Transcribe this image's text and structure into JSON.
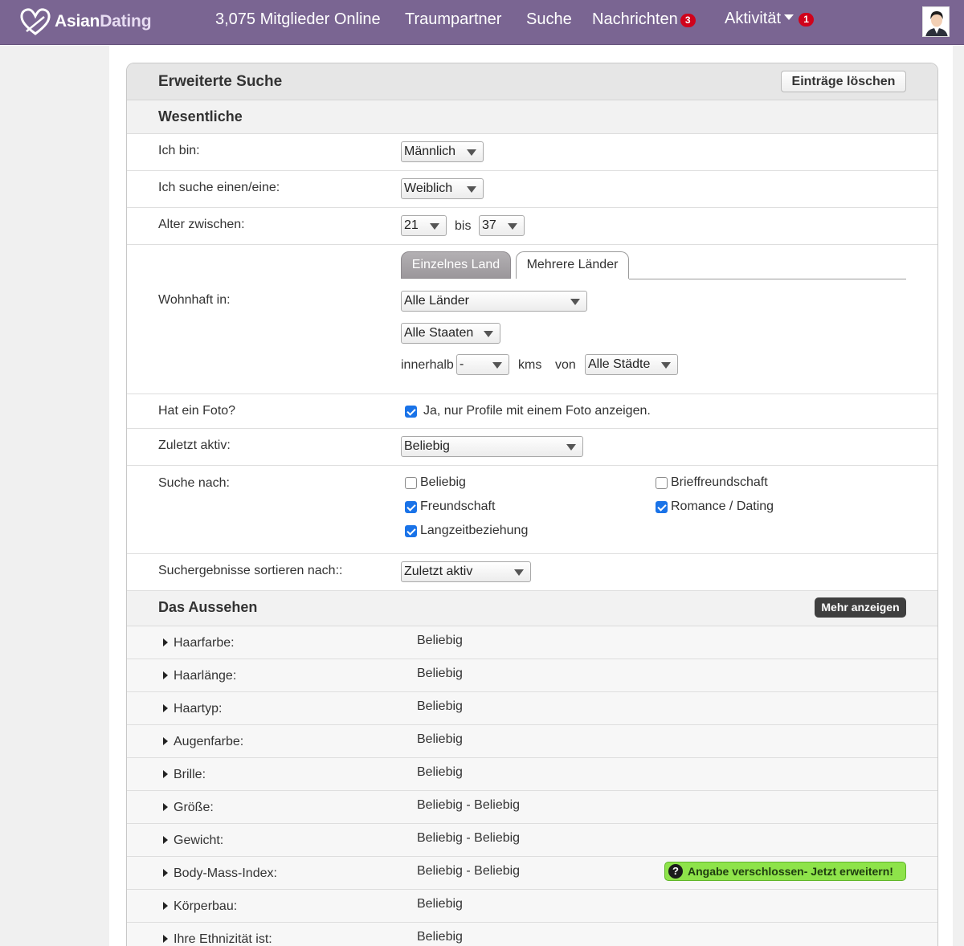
{
  "brand": {
    "name_a": "Asian",
    "name_b": "Dating",
    "color": "#7a6592"
  },
  "nav": {
    "online": "3,075 Mitglieder Online",
    "partner": "Traumpartner",
    "search": "Suche",
    "messages": "Nachrichten",
    "messages_badge": "3",
    "activity": "Aktivität",
    "activity_badge": "1"
  },
  "panel": {
    "title": "Erweiterte Suche",
    "clear_button": "Einträge löschen"
  },
  "essentials": {
    "title": "Wesentliche",
    "i_am": {
      "label": "Ich bin:",
      "value": "Männlich"
    },
    "seeking": {
      "label": "Ich suche einen/eine:",
      "value": "Weiblich"
    },
    "age": {
      "label": "Alter zwischen:",
      "from": "21",
      "between": "bis",
      "to": "37"
    },
    "residence": {
      "label": "Wohnhaft in:",
      "tab_single": "Einzelnes Land",
      "tab_multi": "Mehrere Länder",
      "country": "Alle Länder",
      "state": "Alle Staaten",
      "within_label": "innerhalb",
      "distance": "-",
      "unit": "kms",
      "from_label": "von",
      "city": "Alle Städte"
    },
    "photo": {
      "label": "Hat ein Foto?",
      "text": "Ja, nur Profile mit einem Foto anzeigen.",
      "checked": true
    },
    "last_active": {
      "label": "Zuletzt aktiv:",
      "value": "Beliebig"
    },
    "search_for": {
      "label": "Suche nach:",
      "options": [
        {
          "label": "Beliebig",
          "checked": false
        },
        {
          "label": "Brieffreundschaft",
          "checked": false
        },
        {
          "label": "Freundschaft",
          "checked": true
        },
        {
          "label": "Romance / Dating",
          "checked": true
        },
        {
          "label": "Langzeitbeziehung",
          "checked": true
        }
      ]
    },
    "sort": {
      "label": "Suchergebnisse sortieren nach::",
      "value": "Zuletzt aktiv"
    }
  },
  "appearance": {
    "title": "Das Aussehen",
    "more_button": "Mehr anzeigen",
    "locked_text": "Angabe verschlossen- Jetzt erweitern!",
    "rows": [
      {
        "label": "Haarfarbe:",
        "value": "Beliebig"
      },
      {
        "label": "Haarlänge:",
        "value": "Beliebig"
      },
      {
        "label": "Haartyp:",
        "value": "Beliebig"
      },
      {
        "label": "Augenfarbe:",
        "value": "Beliebig"
      },
      {
        "label": "Brille:",
        "value": "Beliebig"
      },
      {
        "label": "Größe:",
        "value": "Beliebig - Beliebig"
      },
      {
        "label": "Gewicht:",
        "value": "Beliebig - Beliebig"
      },
      {
        "label": "Body-Mass-Index:",
        "value": "Beliebig - Beliebig"
      },
      {
        "label": "Körperbau:",
        "value": "Beliebig"
      },
      {
        "label": "Ihre Ethnizität ist:",
        "value": "Beliebig"
      }
    ]
  }
}
